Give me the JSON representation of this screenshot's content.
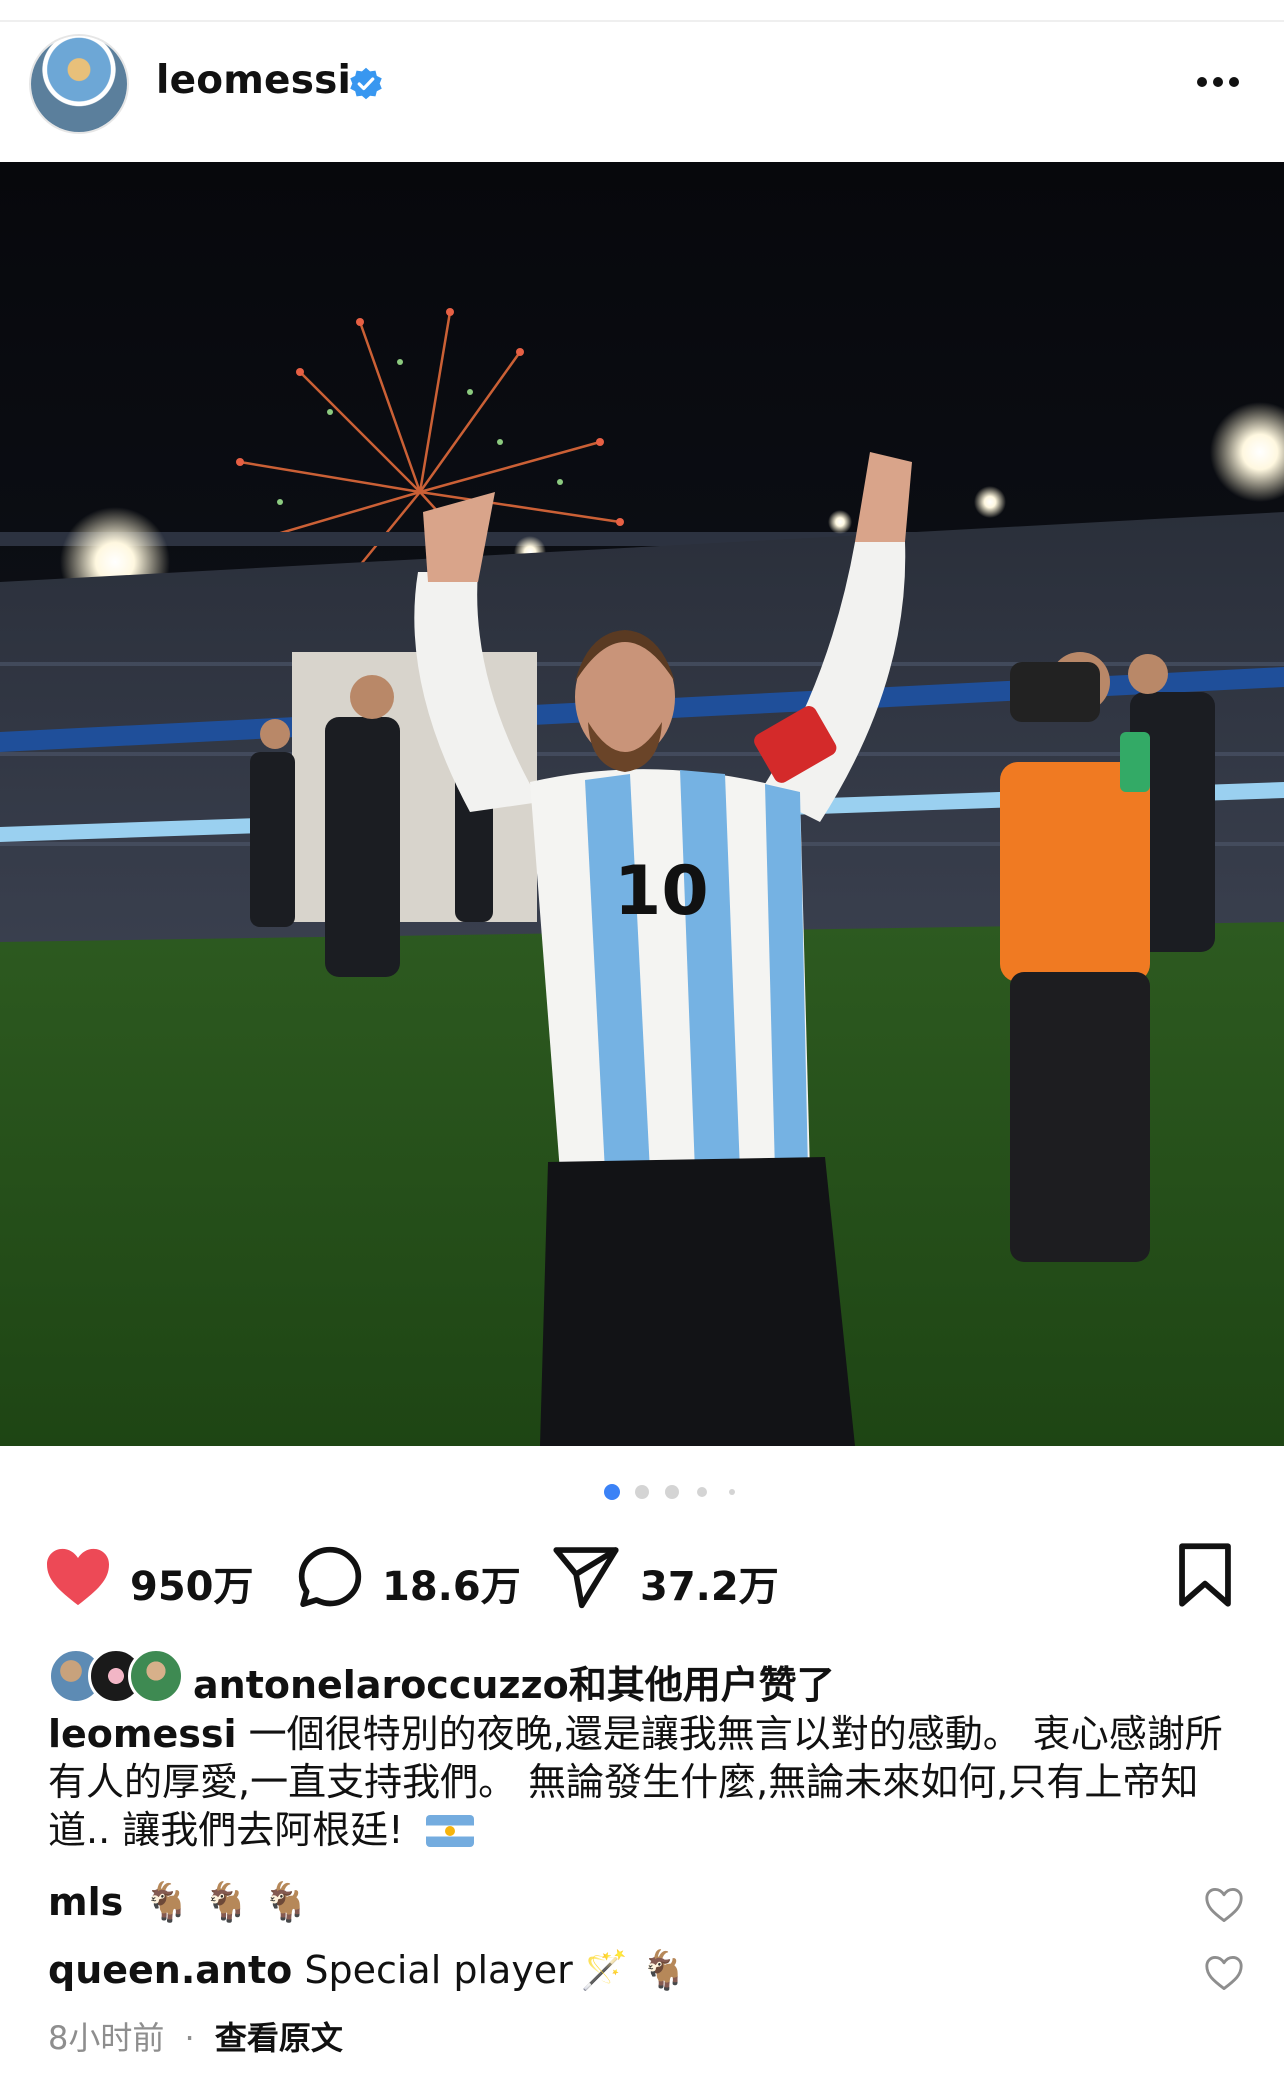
{
  "post": {
    "username": "leomessi",
    "verified": true,
    "avatar": "avatar-messi-trophy",
    "more_icon": "more-horizontal-icon"
  },
  "carousel": {
    "total_slides": 5,
    "active_slide": 1
  },
  "actions": {
    "likes": "950万",
    "comments": "18.6万",
    "shares": "37.2万",
    "like_icon": "heart-filled-icon",
    "comment_icon": "comment-bubble-icon",
    "share_icon": "paper-plane-icon",
    "save_icon": "bookmark-icon",
    "like_color": "#ed4956"
  },
  "liked_by": {
    "user": "antonelaroccuzzo",
    "suffix": "和其他用户赞了"
  },
  "caption": {
    "username": "leomessi",
    "text": "一個很特別的夜晚,還是讓我無言以對的感動。 衷心感謝所有人的厚愛,一直支持我們。 無論發生什麼,無論未來如何,只有上帝知道.. 讓我們去阿根廷!",
    "emoji": "argentina-flag"
  },
  "comments": [
    {
      "username": "mls",
      "text": "",
      "emoji": "🐐 🐐 🐐"
    },
    {
      "username": "queen.anto",
      "text": "Special player",
      "emoji": "🪄 🐐"
    }
  ],
  "meta": {
    "time": "8小时前",
    "separator": "·",
    "see_translation": "查看原文"
  }
}
